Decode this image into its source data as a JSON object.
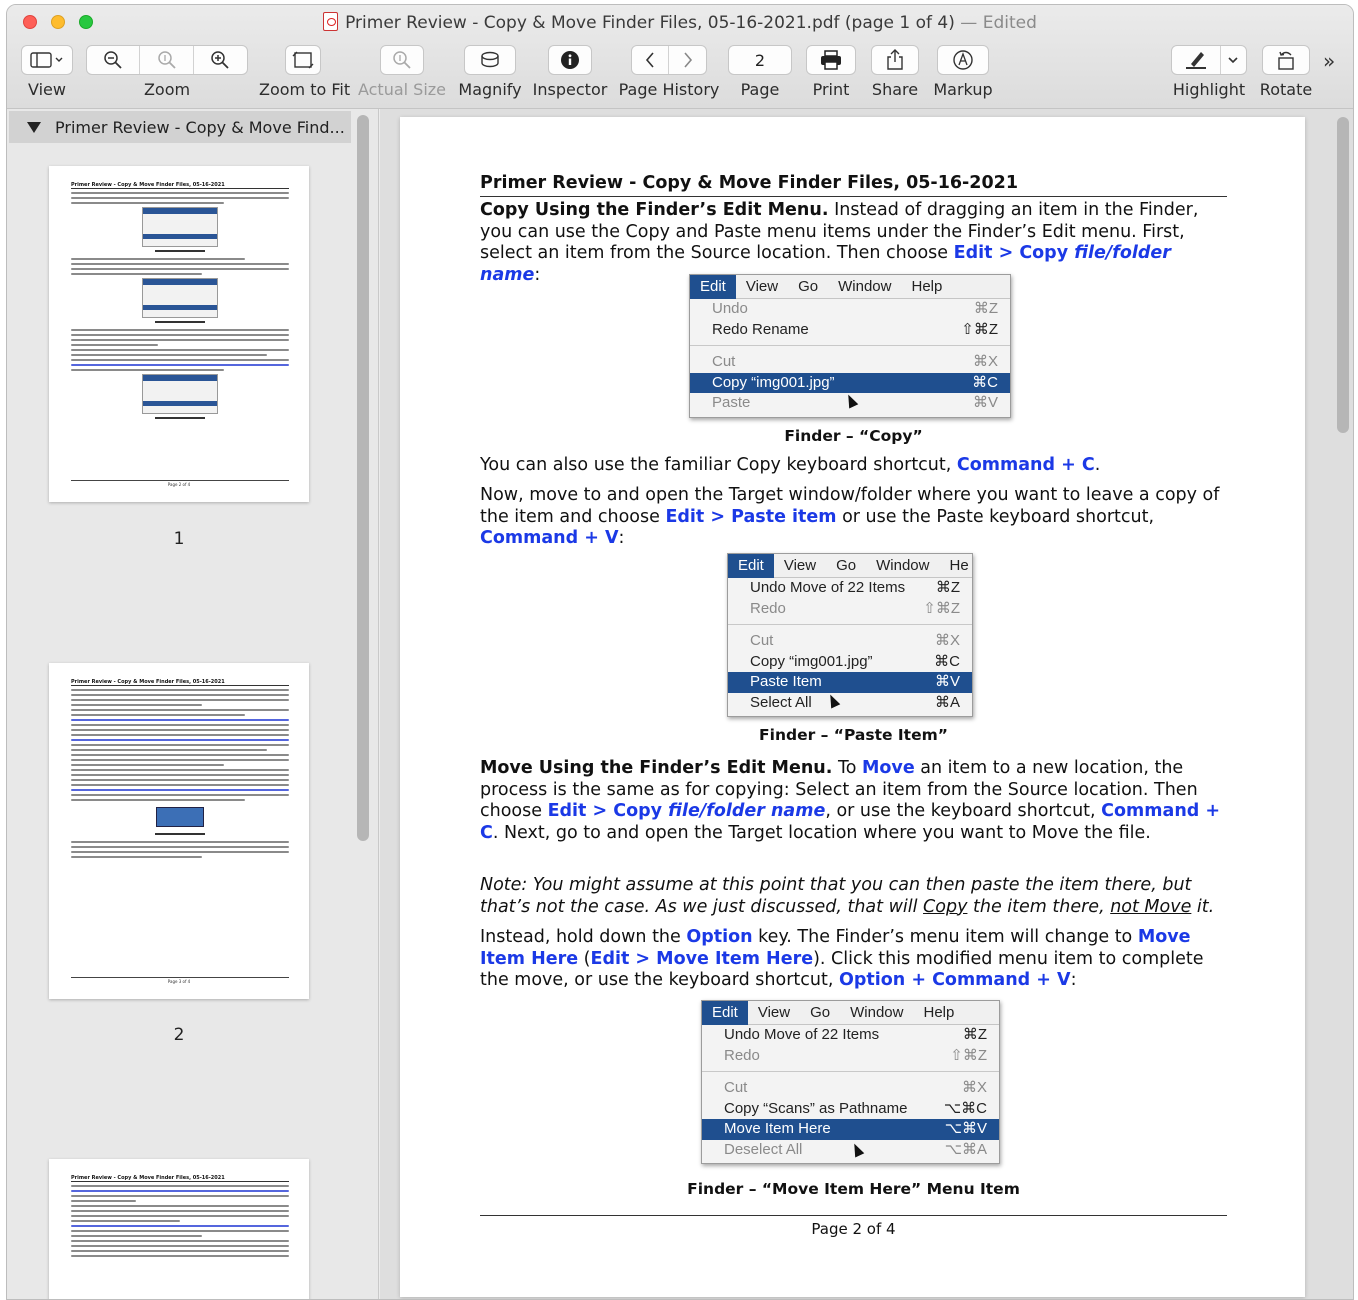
{
  "window": {
    "title": "Primer Review - Copy & Move Finder Files, 05-16-2021.pdf (page 1 of 4)",
    "title_suffix": " — Edited"
  },
  "toolbar": {
    "view": "View",
    "zoom": "Zoom",
    "zoom_to_fit": "Zoom to Fit",
    "actual_size": "Actual Size",
    "magnify": "Magnify",
    "inspector": "Inspector",
    "page_history": "Page History",
    "page_label": "Page",
    "page_value": "2",
    "print": "Print",
    "share": "Share",
    "markup": "Markup",
    "highlight": "Highlight",
    "rotate": "Rotate",
    "overflow": "»"
  },
  "sidebar": {
    "header": "Primer Review - Copy & Move Find...",
    "thumbnails": [
      {
        "number": "1",
        "title": "Primer Review - Copy & Move Finder Files, 05-16-2021",
        "footer": "Page 2 of 4"
      },
      {
        "number": "2",
        "title": "Primer Review - Copy & Move Finder Files, 05-16-2021",
        "footer": "Page 3 of 4"
      },
      {
        "title": "Primer Review - Copy & Move Finder Files, 05-16-2021"
      }
    ]
  },
  "document": {
    "title": "Primer Review - Copy & Move Finder Files, 05-16-2021",
    "p1": {
      "lead": "Copy Using the Finder’s Edit Menu.",
      "text": " Instead of dragging an item in the Finder, you can use the Copy and Paste menu items under the Finder’s Edit menu. First, select an item from the Source location. Then choose ",
      "link1": "Edit > Copy ",
      "link2": "file/folder name",
      "end": ":"
    },
    "menu1": {
      "bar": [
        "Edit",
        "View",
        "Go",
        "Window",
        "Help"
      ],
      "items": [
        {
          "label": "Undo",
          "shortcut": "⌘Z",
          "state": "dim"
        },
        {
          "label": "Redo Rename",
          "shortcut": "⇧⌘Z",
          "state": "normal"
        },
        {
          "label": "Cut",
          "shortcut": "⌘X",
          "state": "dim"
        },
        {
          "label": "Copy “img001.jpg”",
          "shortcut": "⌘C",
          "state": "selected"
        },
        {
          "label": "Paste",
          "shortcut": "⌘V",
          "state": "dim"
        }
      ],
      "caption": "Finder – “Copy”"
    },
    "p2": {
      "text": "You can also use the familiar Copy keyboard shortcut, ",
      "link": "Command + C",
      "end": "."
    },
    "p3": {
      "text1": "Now, move to and open the Target window/folder where you want to leave a copy of the item and choose ",
      "link1": "Edit > Paste item",
      "text2": " or use the Paste keyboard shortcut, ",
      "link2": "Command + V",
      "end": ":"
    },
    "menu2": {
      "bar": [
        "Edit",
        "View",
        "Go",
        "Window",
        "He"
      ],
      "items": [
        {
          "label": "Undo Move of 22 Items",
          "shortcut": "⌘Z",
          "state": "normal"
        },
        {
          "label": "Redo",
          "shortcut": "⇧⌘Z",
          "state": "dim"
        },
        {
          "label": "Cut",
          "shortcut": "⌘X",
          "state": "dim"
        },
        {
          "label": "Copy “img001.jpg”",
          "shortcut": "⌘C",
          "state": "normal"
        },
        {
          "label": "Paste Item",
          "shortcut": "⌘V",
          "state": "selected"
        },
        {
          "label": "Select All",
          "shortcut": "⌘A",
          "state": "normal"
        }
      ],
      "caption": "Finder – “Paste Item”"
    },
    "p4": {
      "lead": "Move Using the Finder’s Edit Menu.",
      "text1": " To ",
      "link1": "Move",
      "text2": " an item to a new location, the process is the same as for copying: Select an item from the Source location. Then choose ",
      "link2": "Edit > Copy ",
      "link2b": "file/folder name",
      "text3": ", or use the keyboard shortcut, ",
      "link3": "Command + C",
      "text4": ". Next, go to and open the Target location where you want to Move the file."
    },
    "p5": {
      "text1": "Note: You might assume at this point that you can then paste the item there, but that’s not the case. As we just discussed, that will ",
      "u1": "Copy",
      "text2": " the item there, ",
      "u2": "not Move",
      "end": " it."
    },
    "p6": {
      "text1": "Instead, hold down the ",
      "link1": "Option",
      "text2": " key. The Finder’s menu item will change to ",
      "link2": "Move Item Here",
      "text3": " (",
      "link3": "Edit > Move Item Here",
      "text4": "). Click this modified menu item to complete the move, or use the keyboard shortcut, ",
      "link4": "Option + Command + V",
      "end": ":"
    },
    "menu3": {
      "bar": [
        "Edit",
        "View",
        "Go",
        "Window",
        "Help"
      ],
      "items": [
        {
          "label": "Undo Move of 22 Items",
          "shortcut": "⌘Z",
          "state": "normal"
        },
        {
          "label": "Redo",
          "shortcut": "⇧⌘Z",
          "state": "dim"
        },
        {
          "label": "Cut",
          "shortcut": "⌘X",
          "state": "dim"
        },
        {
          "label": "Copy “Scans” as Pathname",
          "shortcut": "⌥⌘C",
          "state": "normal"
        },
        {
          "label": "Move Item Here",
          "shortcut": "⌥⌘V",
          "state": "selected"
        },
        {
          "label": "Deselect All",
          "shortcut": "⌥⌘A",
          "state": "dim"
        }
      ],
      "caption": "Finder – “Move Item Here” Menu Item"
    },
    "footer": "Page 2 of 4"
  }
}
